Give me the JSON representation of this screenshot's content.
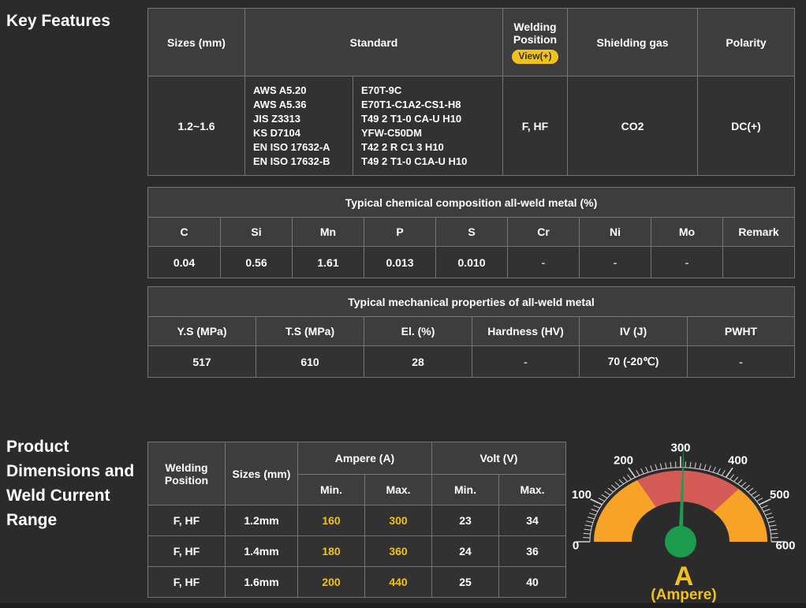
{
  "colors": {
    "accent_gold": "#F2C11C",
    "gauge_orange": "#F7A328",
    "gauge_red": "#D45B56",
    "gauge_green": "#1B9C4F"
  },
  "headings": {
    "key_features": "Key Features",
    "product_dimensions": "Product Dimensions and Weld Current Range"
  },
  "key_features_table": {
    "headers": {
      "sizes": "Sizes (mm)",
      "standard": "Standard",
      "welding_position": "Welding Position",
      "view_badge": "View(+)",
      "shielding_gas": "Shielding gas",
      "polarity": "Polarity"
    },
    "row": {
      "sizes": "1.2~1.6",
      "standards_a": [
        "AWS A5.20",
        "AWS A5.36",
        "JIS Z3313",
        "KS D7104",
        "EN ISO 17632-A",
        "EN ISO 17632-B"
      ],
      "standards_b": [
        "E70T-9C",
        "E70T1-C1A2-CS1-H8",
        "T49 2 T1-0 CA-U H10",
        "YFW-C50DM",
        "T42 2 R C1 3 H10",
        "T49 2 T1-0 C1A-U H10"
      ],
      "welding_position": "F, HF",
      "shielding_gas": "CO2",
      "polarity": "DC(+)"
    }
  },
  "chemical_table": {
    "title": "Typical chemical composition all-weld metal (%)",
    "headers": [
      "C",
      "Si",
      "Mn",
      "P",
      "S",
      "Cr",
      "Ni",
      "Mo",
      "Remark"
    ],
    "values": [
      "0.04",
      "0.56",
      "1.61",
      "0.013",
      "0.010",
      "-",
      "-",
      "-",
      ""
    ]
  },
  "mechanical_table": {
    "title": "Typical mechanical properties of all-weld metal",
    "headers": [
      "Y.S (MPa)",
      "T.S (MPa)",
      "El. (%)",
      "Hardness (HV)",
      "IV (J)",
      "PWHT"
    ],
    "values": [
      "517",
      "610",
      "28",
      "-",
      "70 (-20℃)",
      "-"
    ]
  },
  "current_range_table": {
    "headers": {
      "welding_position": "Welding Position",
      "sizes": "Sizes (mm)",
      "ampere": "Ampere (A)",
      "volt": "Volt (V)",
      "min": "Min.",
      "max": "Max."
    },
    "rows": [
      {
        "welding_position": "F, HF",
        "size": "1.2mm",
        "ampere_min": "160",
        "ampere_max": "300",
        "volt_min": "23",
        "volt_max": "34"
      },
      {
        "welding_position": "F, HF",
        "size": "1.4mm",
        "ampere_min": "180",
        "ampere_max": "360",
        "volt_min": "24",
        "volt_max": "36"
      },
      {
        "welding_position": "F, HF",
        "size": "1.6mm",
        "ampere_min": "200",
        "ampere_max": "440",
        "volt_min": "25",
        "volt_max": "40"
      }
    ]
  },
  "chart_data": {
    "type": "gauge",
    "title": "Weld current range gauge",
    "min": 0,
    "max": 600,
    "tick_interval_minor": 10,
    "tick_interval_major": 100,
    "tick_labels": [
      0,
      100,
      200,
      300,
      400,
      500,
      600
    ],
    "bands": [
      {
        "from": 0,
        "to": 200,
        "color": "#F7A328"
      },
      {
        "from": 200,
        "to": 440,
        "color": "#D45B56"
      },
      {
        "from": 440,
        "to": 600,
        "color": "#F7A328"
      }
    ],
    "needle_value": 305,
    "needle_color": "#1B9C4F",
    "pivot_color": "#1B9C4F",
    "tick_color": "#D8D8D8",
    "label_color": "#FFFFFF",
    "unit_symbol": "A",
    "unit_label": "(Ampere)"
  }
}
